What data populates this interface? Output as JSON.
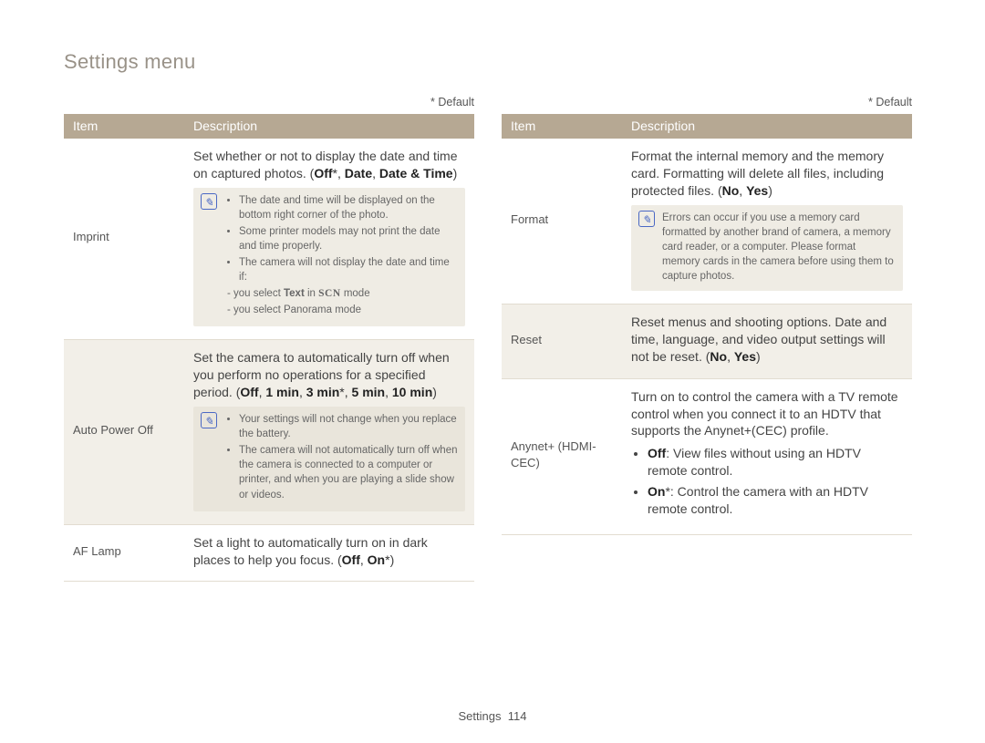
{
  "page_title": "Settings menu",
  "default_marker": "* Default",
  "table_headers": {
    "item": "Item",
    "desc": "Description"
  },
  "left": {
    "rows": [
      {
        "item": "Imprint",
        "intro_pre": "Set whether or not to display the date and time on captured photos. (",
        "options": [
          {
            "t": "Off",
            "b": true,
            "star": true
          },
          {
            "t": "Date",
            "b": true
          },
          {
            "t": "Date & Time",
            "b": true
          }
        ],
        "intro_post": ")",
        "note": [
          "The date and time will be displayed on the bottom right corner of the photo.",
          "Some printer models may not print the date and time properly.",
          "The camera will not display the date and time if:"
        ],
        "note_sub": [
          "you select <b>Text</b> in <span class=\"scn\">SCN</span> mode",
          "you select Panorama mode"
        ]
      },
      {
        "item": "Auto Power Off",
        "intro_pre": "Set the camera to automatically turn off when you perform no operations for a specified period. (",
        "options": [
          {
            "t": "Off",
            "b": true
          },
          {
            "t": "1 min",
            "b": true
          },
          {
            "t": "3 min",
            "b": true,
            "star": true
          },
          {
            "t": "5 min",
            "b": true
          },
          {
            "t": "10 min",
            "b": true
          }
        ],
        "intro_post": ")",
        "note": [
          "Your settings will not change when you replace the battery.",
          "The camera will not automatically turn off when the camera is connected to a computer or printer, and when you are playing a slide show or videos."
        ]
      },
      {
        "item": "AF Lamp",
        "intro_pre": "Set a light to automatically turn on in dark places to help you focus. (",
        "options": [
          {
            "t": "Off",
            "b": true
          },
          {
            "t": "On",
            "b": true,
            "star": true
          }
        ],
        "intro_post": ")"
      }
    ]
  },
  "right": {
    "rows": [
      {
        "item": "Format",
        "intro_pre": "Format the internal memory and the memory card. Formatting will delete all files, including protected files. (",
        "options": [
          {
            "t": "No",
            "b": true
          },
          {
            "t": "Yes",
            "b": true
          }
        ],
        "intro_post": ")",
        "note_plain": "Errors can occur if you use a memory card formatted by another brand of camera, a memory card reader, or a computer. Please format memory cards in the camera before using them to capture photos."
      },
      {
        "item": "Reset",
        "intro_pre": "Reset menus and shooting options. Date and time, language, and video output settings will not be reset. (",
        "options": [
          {
            "t": "No",
            "b": true
          },
          {
            "t": "Yes",
            "b": true
          }
        ],
        "intro_post": ")"
      },
      {
        "item": "Anynet+ (HDMI-CEC)",
        "intro_full": "Turn on to control the camera with a TV remote control when you connect it to an HDTV that supports the Anynet+(CEC) profile.",
        "bullets": [
          {
            "label": "Off",
            "star": false,
            "text": ": View files without using an HDTV remote control."
          },
          {
            "label": "On",
            "star": true,
            "text": ": Control the camera with an HDTV remote control."
          }
        ]
      }
    ]
  },
  "footer": {
    "section": "Settings",
    "page": "114"
  }
}
